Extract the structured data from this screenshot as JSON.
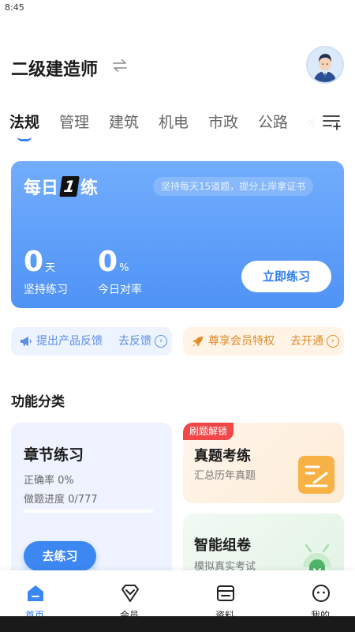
{
  "status_bar": {
    "time": "8:45"
  },
  "header": {
    "title": "二级建造师",
    "swap_icon": "swap-arrows-icon",
    "avatar_icon": "user-avatar-icon"
  },
  "tabs": {
    "items": [
      "法规",
      "管理",
      "建筑",
      "机电",
      "市政",
      "公路",
      "水"
    ],
    "active_index": 0,
    "menu_icon": "list-add-icon",
    "accent": "#3a86f5"
  },
  "hero": {
    "title_prefix": "每日",
    "title_number": "1",
    "title_suffix": "练",
    "tagline": "坚持每天15道题，提分上岸拿证书",
    "stats": [
      {
        "value": "0",
        "unit": "天",
        "label": "坚持练习"
      },
      {
        "value": "0",
        "unit": "%",
        "label": "今日对率"
      }
    ],
    "button": "立即练习",
    "gradient": [
      "#72adfc",
      "#4f93f6"
    ]
  },
  "pills": {
    "feedback": {
      "icon": "megaphone-icon",
      "text": "提出产品反馈",
      "action": "去反馈"
    },
    "vip": {
      "icon": "rocket-icon",
      "text": "尊享会员特权",
      "action": "去开通"
    }
  },
  "section": {
    "title": "功能分类"
  },
  "chapter_card": {
    "title": "章节练习",
    "accuracy": "正确率 0%",
    "progress_text": "做题进度 0/777",
    "progress_fraction": 0,
    "button": "去练习"
  },
  "real_exam_card": {
    "badge": "刷题解锁",
    "title": "真题考练",
    "desc": "汇总历年真题",
    "icon": "document-edit-icon"
  },
  "smart_card": {
    "title": "智能组卷",
    "desc": "模拟真实考试",
    "icon": "android-icon"
  },
  "bottom_nav": [
    {
      "label": "首页",
      "icon": "home-icon",
      "active": true
    },
    {
      "label": "会员",
      "icon": "vip-diamond-icon",
      "active": false
    },
    {
      "label": "资料",
      "icon": "materials-icon",
      "active": false
    },
    {
      "label": "我的",
      "icon": "profile-smile-icon",
      "active": false
    }
  ]
}
